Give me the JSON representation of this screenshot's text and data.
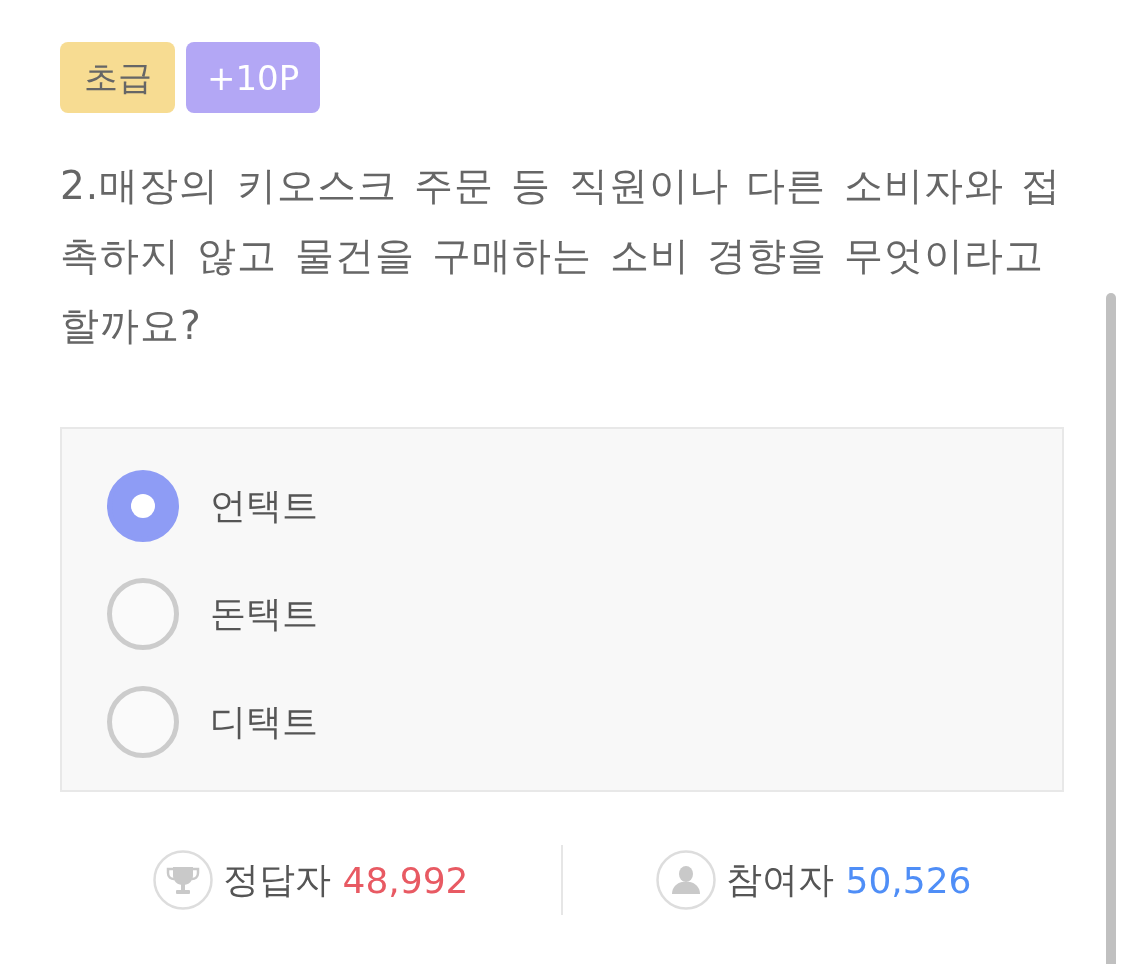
{
  "badges": [
    {
      "kind": "level",
      "label": "초급"
    },
    {
      "kind": "points",
      "label": "+10P"
    }
  ],
  "question": "2.매장의 키오스크 주문 등 직원이나 다른 소비자와 접촉하지 않고 물건을 구매하는 소비 경향을 무엇이라고 할까요?",
  "options": [
    {
      "label": "언택트",
      "selected": true
    },
    {
      "label": "돈택트",
      "selected": false
    },
    {
      "label": "디택트",
      "selected": false
    }
  ],
  "stats": [
    {
      "kind": "correct",
      "label": "정답자",
      "count": "48,992",
      "color": "#e85a63"
    },
    {
      "kind": "participants",
      "label": "참여자",
      "count": "50,526",
      "color": "#4f8ef7"
    }
  ]
}
